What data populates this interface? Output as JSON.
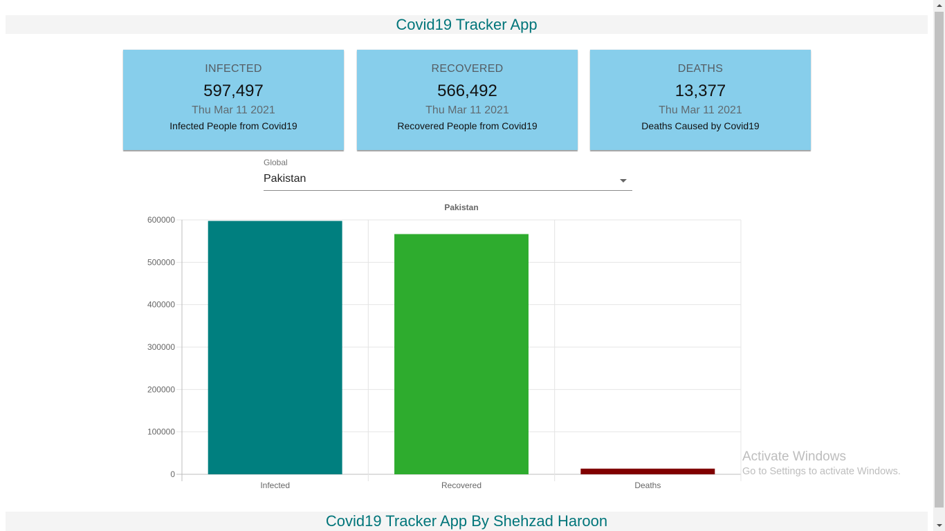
{
  "app": {
    "title": "Covid19 Tracker App",
    "footer": "Covid19 Tracker App By Shehzad Haroon"
  },
  "cards": [
    {
      "title": "INFECTED",
      "count": "597,497",
      "date": "Thu Mar 11 2021",
      "desc": "Infected People from Covid19"
    },
    {
      "title": "RECOVERED",
      "count": "566,492",
      "date": "Thu Mar 11 2021",
      "desc": "Recovered People from Covid19"
    },
    {
      "title": "DEATHS",
      "count": "13,377",
      "date": "Thu Mar 11 2021",
      "desc": "Deaths Caused by Covid19"
    }
  ],
  "country_select": {
    "label": "Global",
    "value": "Pakistan"
  },
  "chart_data": {
    "type": "bar",
    "title": "Pakistan",
    "categories": [
      "Infected",
      "Recovered",
      "Deaths"
    ],
    "values": [
      597497,
      566492,
      13377
    ],
    "colors": [
      "#007f7f",
      "#2eac2e",
      "#800000"
    ],
    "ylim": [
      0,
      600000
    ],
    "yticks": [
      0,
      100000,
      200000,
      300000,
      400000,
      500000,
      600000
    ],
    "ytick_labels": [
      "0",
      "100000",
      "200000",
      "300000",
      "400000",
      "500000",
      "600000"
    ],
    "grid": true,
    "legend": "none"
  },
  "watermark": {
    "title": "Activate Windows",
    "subtitle": "Go to Settings to activate Windows."
  },
  "colors": {
    "accent": "#00757a",
    "card_bg": "#87ceeb",
    "bar_strip_bg": "#f4f4f4"
  }
}
